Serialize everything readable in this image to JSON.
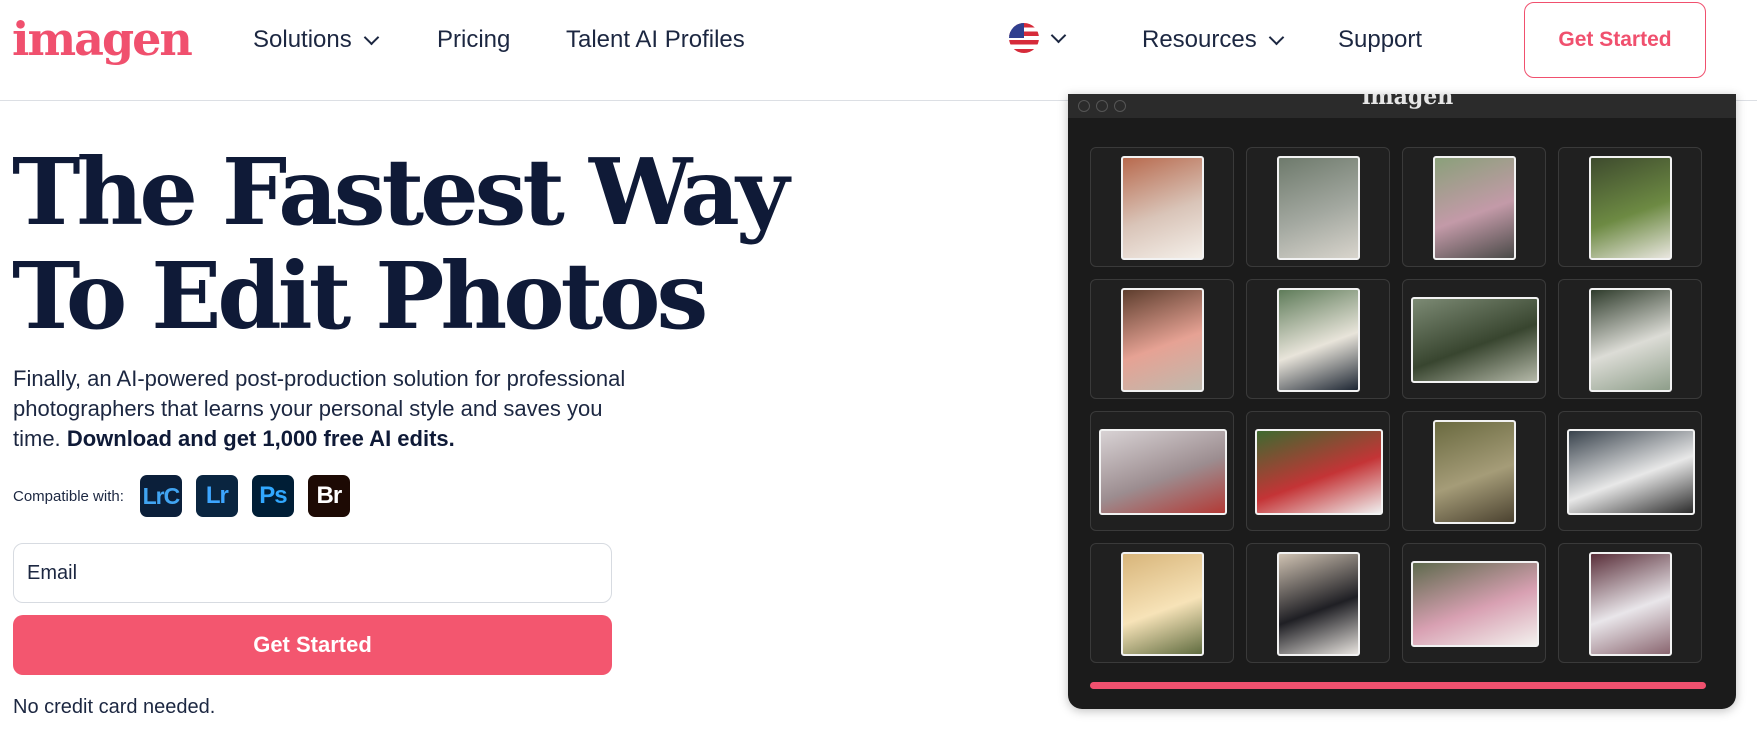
{
  "brand": {
    "logo_text": "imagen",
    "accent_color": "#f0506e"
  },
  "nav": {
    "items": [
      {
        "label": "Solutions",
        "has_dropdown": true
      },
      {
        "label": "Pricing",
        "has_dropdown": false
      },
      {
        "label": "Talent AI Profiles",
        "has_dropdown": false
      }
    ],
    "language": {
      "icon": "us-flag-icon",
      "has_dropdown": true
    },
    "right_items": [
      {
        "label": "Resources",
        "has_dropdown": true
      },
      {
        "label": "Support",
        "has_dropdown": false
      }
    ],
    "cta_label": "Get Started"
  },
  "hero": {
    "title_line1": "The Fastest Way",
    "title_line2": "To Edit Photos",
    "subtitle": "Finally, an AI-powered post-production solution for professional photographers that learns your personal style and saves you time.",
    "subtitle_bold": "Download and get 1,000 free AI edits.",
    "compatible_label": "Compatible with:",
    "apps": [
      {
        "label": "LrC",
        "name": "lightroom-classic-icon"
      },
      {
        "label": "Lr",
        "name": "lightroom-icon"
      },
      {
        "label": "Ps",
        "name": "photoshop-icon"
      },
      {
        "label": "Br",
        "name": "bridge-icon"
      }
    ],
    "email_placeholder": "Email",
    "email_value": "",
    "cta_label": "Get Started",
    "note": "No credit card needed."
  },
  "app_window": {
    "title": "imagen",
    "progress": 1.0,
    "photos": [
      {
        "orientation": "portrait",
        "colors": [
          "#b86a4e",
          "#d9c4b8",
          "#f4efe9"
        ]
      },
      {
        "orientation": "portrait",
        "colors": [
          "#6e7a6c",
          "#a3a8a0",
          "#d8d4cc"
        ]
      },
      {
        "orientation": "portrait",
        "colors": [
          "#8aa07a",
          "#c39aa8",
          "#4a4a48"
        ]
      },
      {
        "orientation": "portrait",
        "colors": [
          "#3e4b2e",
          "#6d8a43",
          "#e9e6df"
        ]
      },
      {
        "orientation": "portrait",
        "colors": [
          "#5e3e2e",
          "#e6a294",
          "#bfb9ad"
        ]
      },
      {
        "orientation": "portrait",
        "colors": [
          "#5f7c5a",
          "#e8e4da",
          "#1d2633"
        ]
      },
      {
        "orientation": "landscape",
        "colors": [
          "#7c8a74",
          "#38452f",
          "#b4b8a8"
        ]
      },
      {
        "orientation": "portrait",
        "colors": [
          "#2f3c2c",
          "#dcdcd6",
          "#8e9e8a"
        ]
      },
      {
        "orientation": "landscape",
        "colors": [
          "#d8d2d4",
          "#9c8d90",
          "#b33a36"
        ]
      },
      {
        "orientation": "landscape",
        "colors": [
          "#3e6a30",
          "#c43436",
          "#efefef"
        ]
      },
      {
        "orientation": "portrait",
        "colors": [
          "#6a6a40",
          "#a59c78",
          "#4b4230"
        ]
      },
      {
        "orientation": "landscape",
        "colors": [
          "#39434d",
          "#e8e8e8",
          "#2b2b2b"
        ]
      },
      {
        "orientation": "portrait",
        "colors": [
          "#d8b57a",
          "#f7e3b8",
          "#606c40"
        ]
      },
      {
        "orientation": "portrait",
        "colors": [
          "#cfc2b2",
          "#1f1f24",
          "#e7e3de"
        ]
      },
      {
        "orientation": "landscape",
        "colors": [
          "#5e6a4d",
          "#d8a0b2",
          "#f3f1ee"
        ]
      },
      {
        "orientation": "portrait",
        "colors": [
          "#5a2f3a",
          "#e9e6ea",
          "#8a6670"
        ]
      }
    ]
  }
}
